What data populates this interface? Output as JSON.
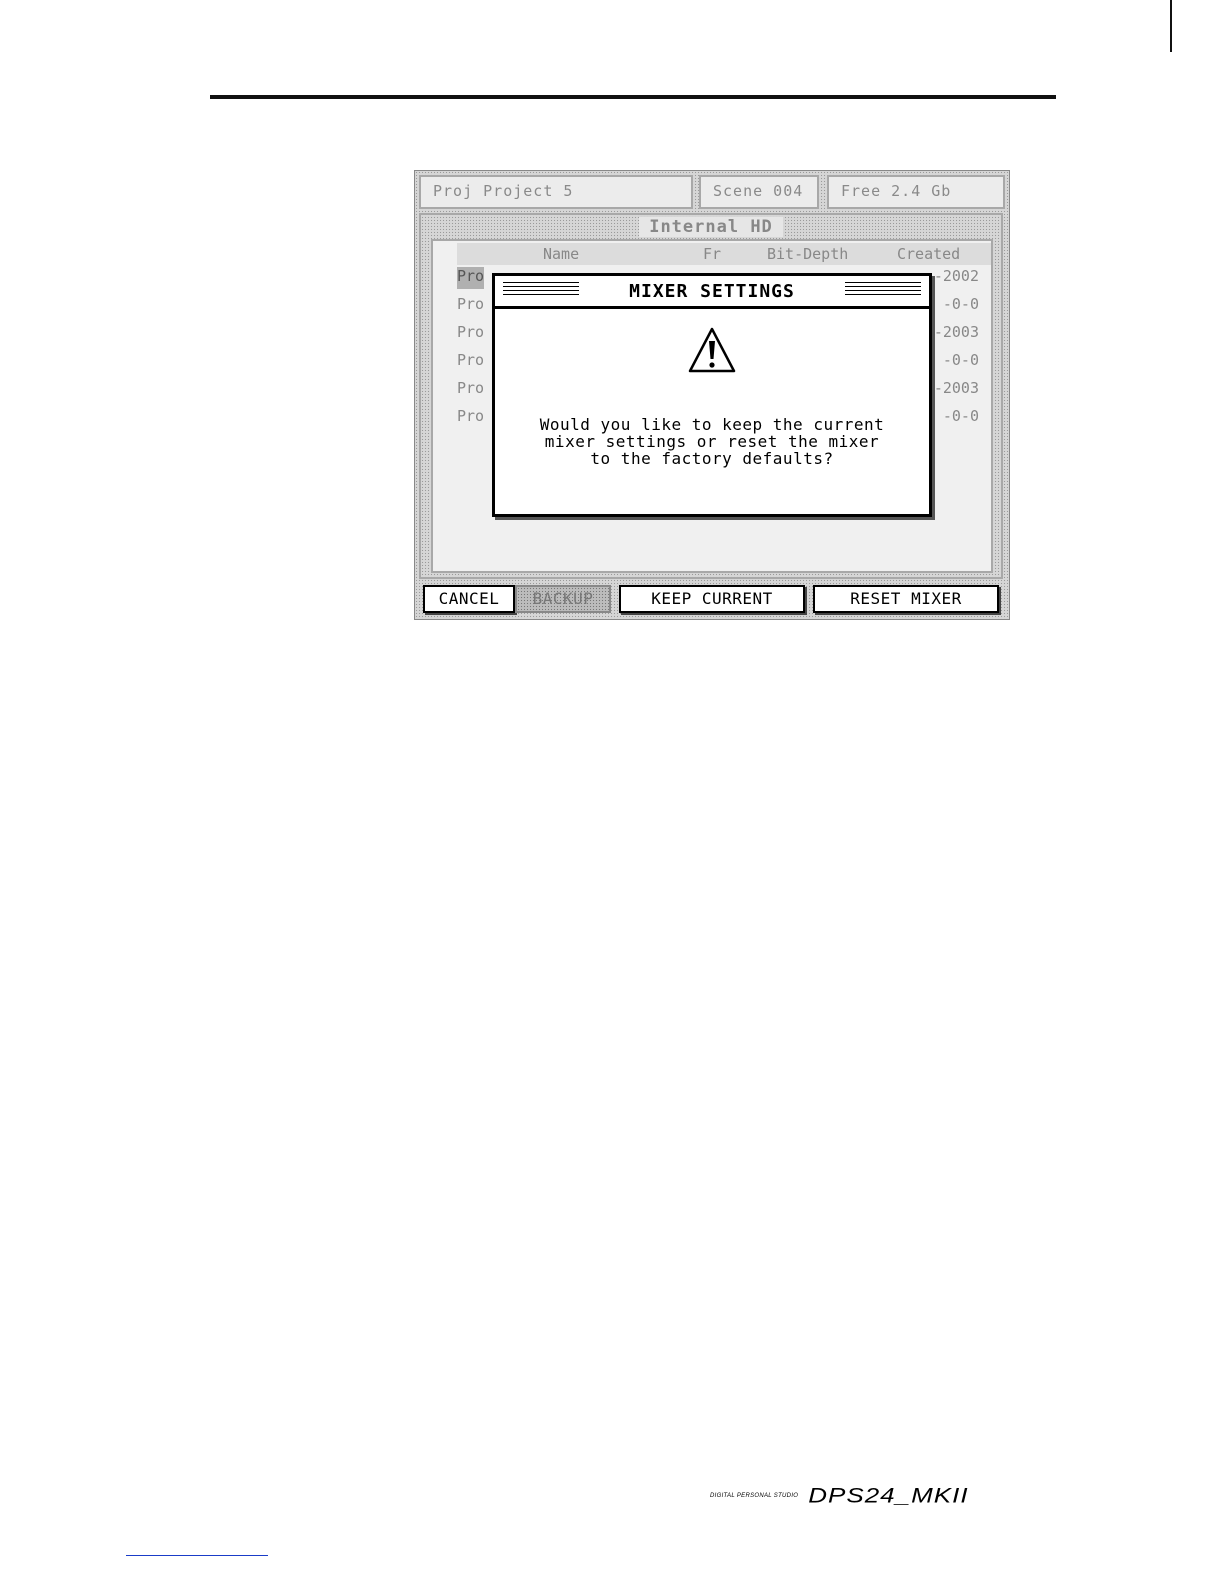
{
  "header": {
    "project": "Proj Project 5",
    "scene": "Scene 004",
    "free": "Free 2.4 Gb"
  },
  "panel": {
    "title": "Internal HD",
    "columns": [
      "Name",
      "Fr",
      "Bit-Depth",
      "Created"
    ],
    "rows": [
      {
        "left": "Pro",
        "right": "-2002"
      },
      {
        "left": "Pro",
        "right": "-0-0"
      },
      {
        "left": "Pro",
        "right": "-2003"
      },
      {
        "left": "Pro",
        "right": "-0-0"
      },
      {
        "left": "Pro",
        "right": "-2003"
      },
      {
        "left": "Pro",
        "right": "-0-0"
      }
    ]
  },
  "dialog": {
    "title": "MIXER SETTINGS",
    "icon": "warning-icon",
    "message": "Would you like to keep the current\nmixer settings or reset the mixer\nto the factory defaults?"
  },
  "buttons": {
    "cancel": "CANCEL",
    "disabled": "BACKUP",
    "keep": "KEEP CURRENT",
    "reset": "RESET MIXER"
  },
  "footer": {
    "brand_small": "DIGITAL PERSONAL STUDIO",
    "brand_big": "DPS24_MKII"
  }
}
